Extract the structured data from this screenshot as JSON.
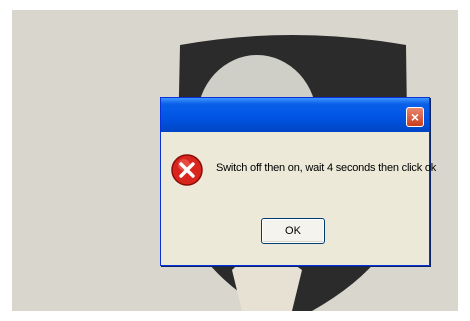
{
  "dialog": {
    "title": "",
    "message": "Switch off then on, wait 4 seconds then click ok",
    "ok_label": "OK",
    "close_label": "×",
    "icon": "error-icon"
  },
  "colors": {
    "titlebar": "#0055e5",
    "dialog_body": "#ece9d8",
    "close_button": "#cc3d1d",
    "desktop": "#d9d6cd"
  }
}
